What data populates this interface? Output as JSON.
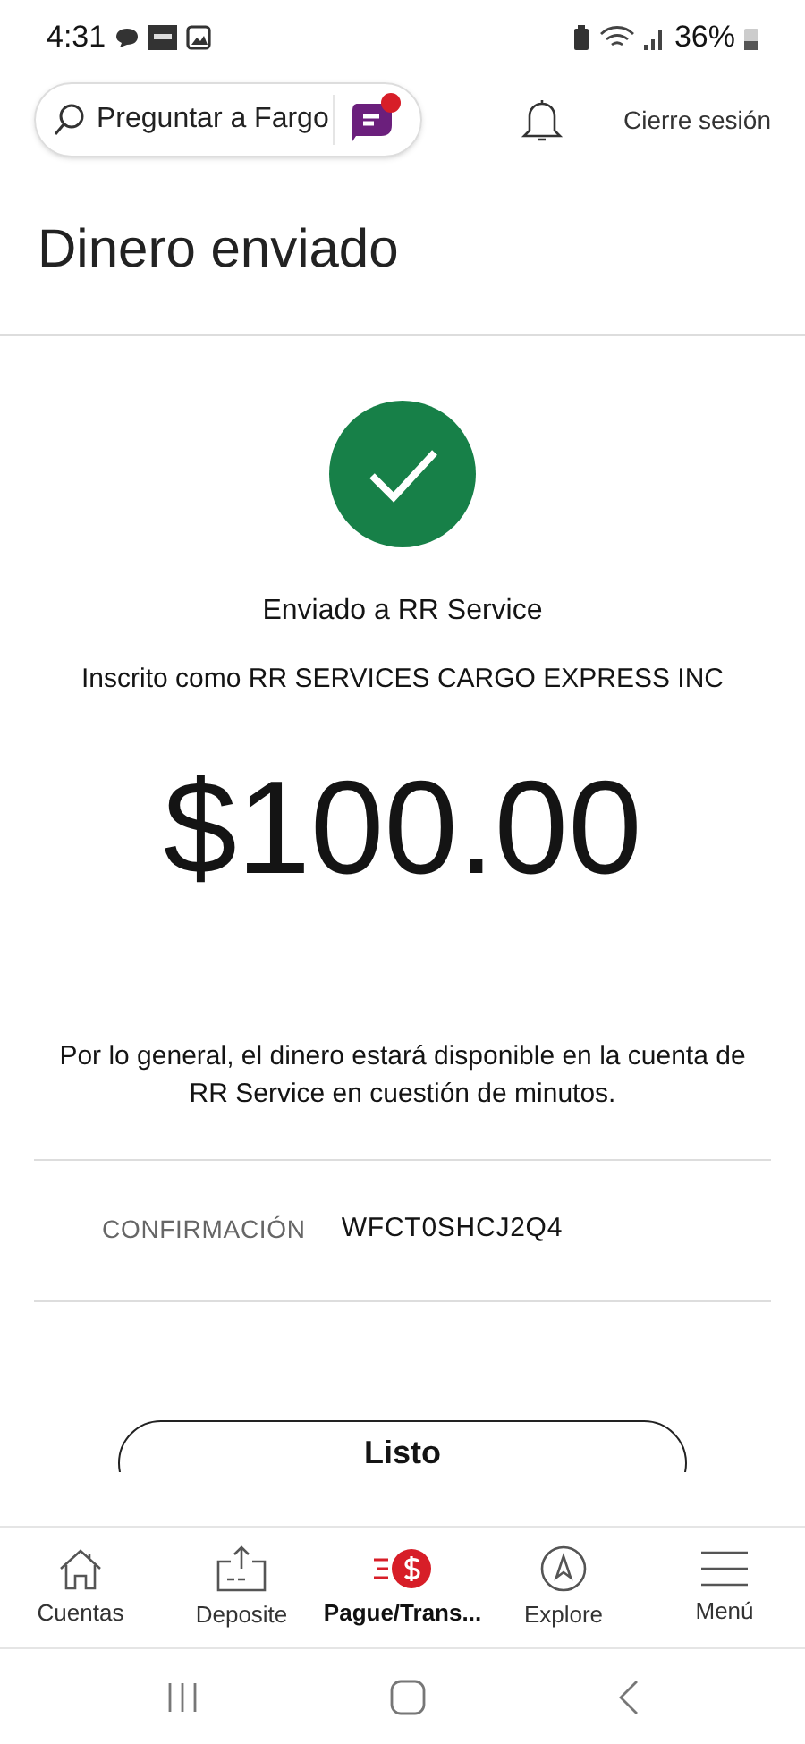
{
  "status_bar": {
    "time": "4:31",
    "battery": "36%"
  },
  "header": {
    "search": {
      "placeholder": "Preguntar a Fargo",
      "has_notification": true
    },
    "logout": "Cierre sesión"
  },
  "title": "Dinero enviado",
  "result": {
    "sent_to": "Enviado a RR Service",
    "enrolled_as": "Inscrito como RR SERVICES CARGO EXPRESS INC",
    "amount": "$100.00",
    "note": "Por lo general, el dinero estará disponible en la cuenta de RR Service en cuestión de minutos.",
    "confirmation_label": "CONFIRMACIÓN",
    "confirmation_value": "WFCT0SHCJ2Q4"
  },
  "done_button": "Listo",
  "bottom_nav": [
    {
      "label": "Cuentas",
      "kind": "home",
      "selected": false
    },
    {
      "label": "Deposite",
      "kind": "deposit",
      "selected": false
    },
    {
      "label": "Pague/Trans...",
      "kind": "pay",
      "selected": true
    },
    {
      "label": "Explore",
      "kind": "explore",
      "selected": false
    },
    {
      "label": "Menú",
      "kind": "menu",
      "selected": false
    }
  ]
}
